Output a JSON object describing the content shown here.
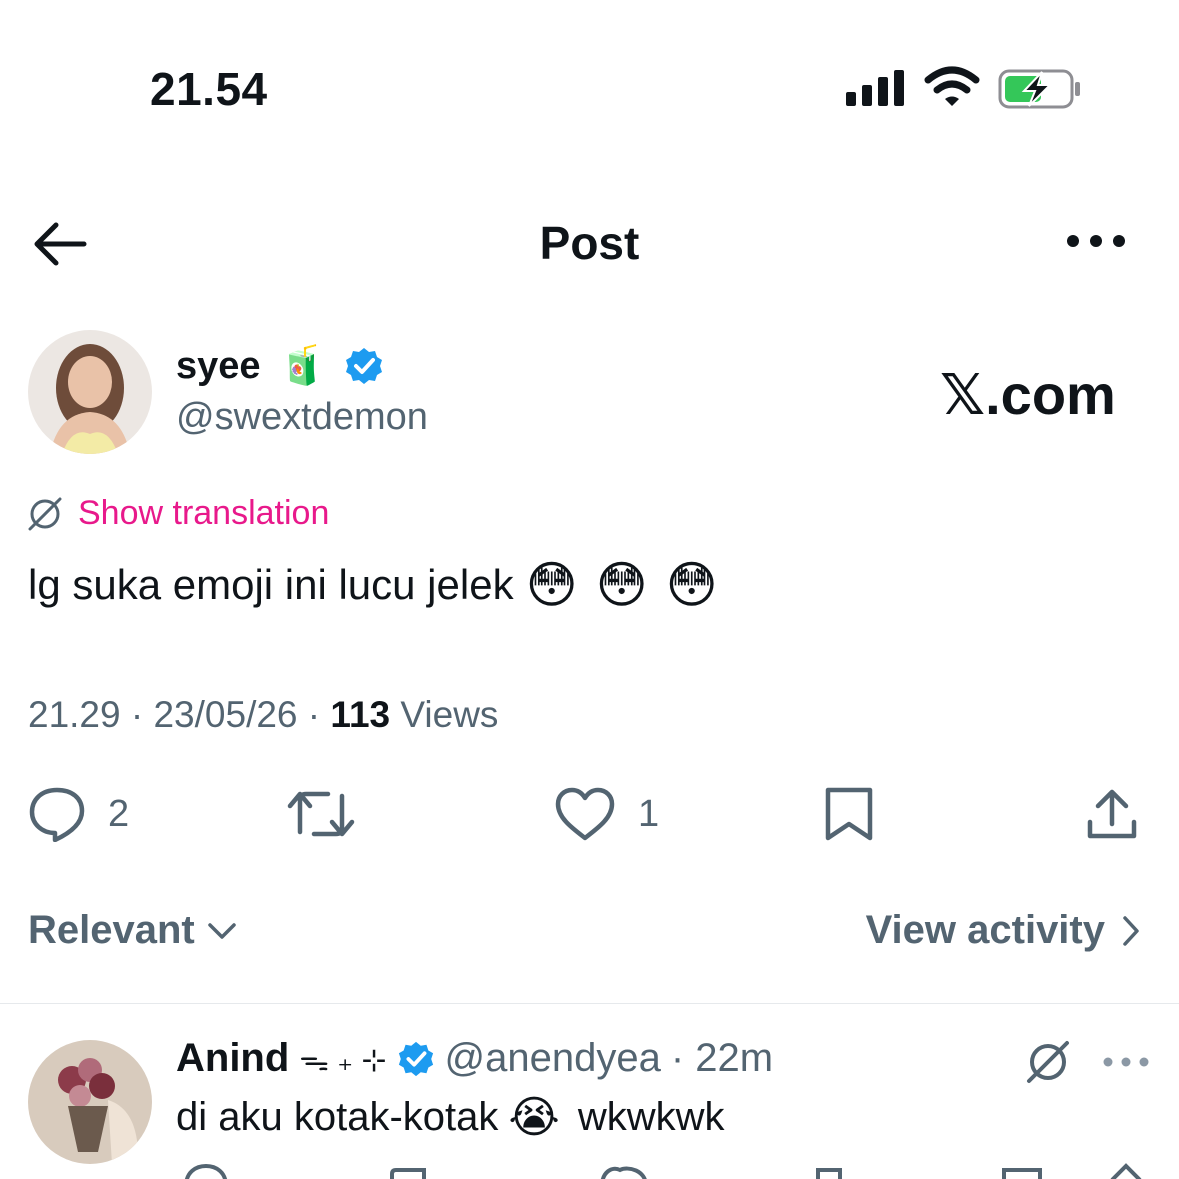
{
  "status_bar": {
    "time": "21.54"
  },
  "header": {
    "title": "Post"
  },
  "post": {
    "display_name": "syee",
    "name_emoji": "🧃",
    "handle": "@swextdemon",
    "watermark": "𝕏.com",
    "translate_label": "Show translation",
    "text": "lg suka emoji ini lucu jelek",
    "text_emojis": "😳 😳 😳",
    "time": "21.29",
    "date": "23/05/26",
    "views_count": "113",
    "views_label": "Views",
    "reply_count": "2",
    "like_count": "1"
  },
  "sort": {
    "label": "Relevant",
    "activity_label": "View activity"
  },
  "reply": {
    "display_name": "Anind",
    "name_decoration": "ᯓ ₊ ⊹",
    "handle": "@anendyea",
    "time": "· 22m",
    "text": "di aku kotak-kotak",
    "text_emoji": "😭",
    "text_suffix": "wkwkwk"
  },
  "colors": {
    "primary_text": "#0f1419",
    "secondary_text": "#536471",
    "translate_pink": "#e8198b",
    "verified_blue": "#1d9bf0",
    "battery_green": "#34c759"
  }
}
